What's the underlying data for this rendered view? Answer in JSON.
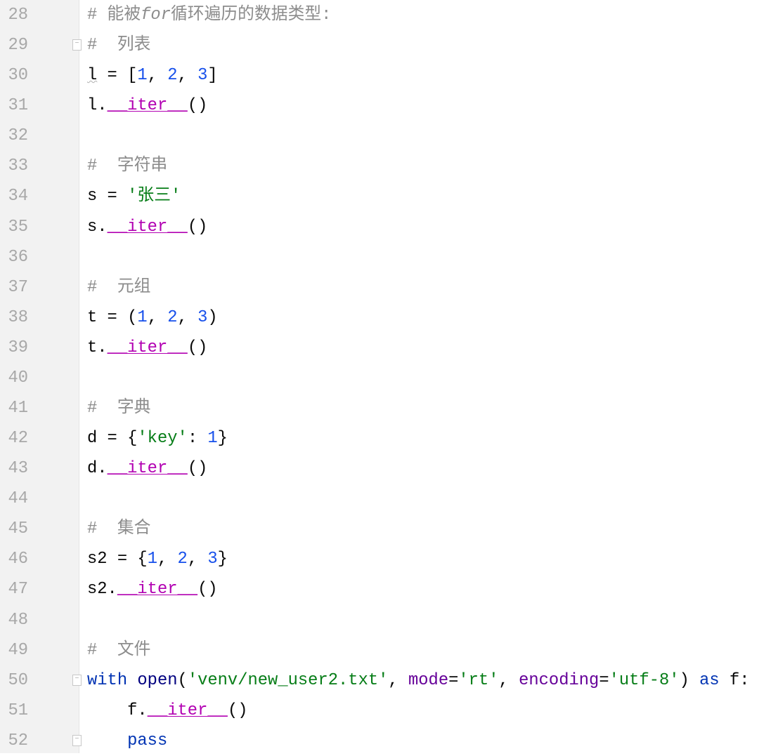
{
  "editor": {
    "colors": {
      "comment": "#8c8c8c",
      "number": "#1750eb",
      "string": "#067d17",
      "dunder": "#b200b2",
      "keyword": "#0033b3",
      "builtin": "#000080",
      "param": "#660099",
      "gutter_bg": "#f2f2f2"
    },
    "lines": [
      {
        "n": "28",
        "tokens": [
          [
            "# 能被",
            "comment"
          ],
          [
            "for",
            "italic"
          ],
          [
            "循环遍历的数据类型:",
            "comment"
          ]
        ]
      },
      {
        "n": "29",
        "fold": "fold-start-icon",
        "tokens": [
          [
            "#  列表",
            "comment"
          ]
        ]
      },
      {
        "n": "30",
        "tokens": [
          [
            "l",
            "warn"
          ],
          [
            " = [",
            ""
          ],
          [
            "1",
            "number"
          ],
          [
            ", ",
            ""
          ],
          [
            "2",
            "number"
          ],
          [
            ", ",
            ""
          ],
          [
            "3",
            "number"
          ],
          [
            "]",
            ""
          ]
        ]
      },
      {
        "n": "31",
        "tokens": [
          [
            "l.",
            ""
          ],
          [
            "__iter__",
            "dunder"
          ],
          [
            "()",
            ""
          ]
        ]
      },
      {
        "n": "32",
        "tokens": []
      },
      {
        "n": "33",
        "tokens": [
          [
            "#  字符串",
            "comment"
          ]
        ]
      },
      {
        "n": "34",
        "tokens": [
          [
            "s = ",
            ""
          ],
          [
            "'张三'",
            "string"
          ]
        ]
      },
      {
        "n": "35",
        "tokens": [
          [
            "s.",
            ""
          ],
          [
            "__iter__",
            "dunder"
          ],
          [
            "()",
            ""
          ]
        ]
      },
      {
        "n": "36",
        "tokens": []
      },
      {
        "n": "37",
        "tokens": [
          [
            "#  元组",
            "comment"
          ]
        ]
      },
      {
        "n": "38",
        "tokens": [
          [
            "t = (",
            ""
          ],
          [
            "1",
            "number"
          ],
          [
            ", ",
            ""
          ],
          [
            "2",
            "number"
          ],
          [
            ", ",
            ""
          ],
          [
            "3",
            "number"
          ],
          [
            ")",
            ""
          ]
        ]
      },
      {
        "n": "39",
        "tokens": [
          [
            "t.",
            ""
          ],
          [
            "__iter__",
            "dunder"
          ],
          [
            "()",
            ""
          ]
        ]
      },
      {
        "n": "40",
        "tokens": []
      },
      {
        "n": "41",
        "tokens": [
          [
            "#  字典",
            "comment"
          ]
        ]
      },
      {
        "n": "42",
        "tokens": [
          [
            "d = {",
            ""
          ],
          [
            "'key'",
            "string"
          ],
          [
            ": ",
            ""
          ],
          [
            "1",
            "number"
          ],
          [
            "}",
            ""
          ]
        ]
      },
      {
        "n": "43",
        "tokens": [
          [
            "d.",
            ""
          ],
          [
            "__iter__",
            "dunder"
          ],
          [
            "()",
            ""
          ]
        ]
      },
      {
        "n": "44",
        "tokens": []
      },
      {
        "n": "45",
        "tokens": [
          [
            "#  集合",
            "comment"
          ]
        ]
      },
      {
        "n": "46",
        "tokens": [
          [
            "s2 = {",
            ""
          ],
          [
            "1",
            "number"
          ],
          [
            ", ",
            ""
          ],
          [
            "2",
            "number"
          ],
          [
            ", ",
            ""
          ],
          [
            "3",
            "number"
          ],
          [
            "}",
            ""
          ]
        ]
      },
      {
        "n": "47",
        "tokens": [
          [
            "s2.",
            ""
          ],
          [
            "__iter__",
            "dunder"
          ],
          [
            "()",
            ""
          ]
        ]
      },
      {
        "n": "48",
        "tokens": []
      },
      {
        "n": "49",
        "tokens": [
          [
            "#  文件",
            "comment"
          ]
        ]
      },
      {
        "n": "50",
        "fold": "fold-start-icon",
        "tokens": [
          [
            "with",
            "keyword"
          ],
          [
            " ",
            ""
          ],
          [
            "open",
            "builtin"
          ],
          [
            "(",
            ""
          ],
          [
            "'venv/new_user2.txt'",
            "string"
          ],
          [
            ", ",
            ""
          ],
          [
            "mode",
            "param"
          ],
          [
            "=",
            ""
          ],
          [
            "'rt'",
            "string"
          ],
          [
            ", ",
            ""
          ],
          [
            "encoding",
            "param"
          ],
          [
            "=",
            ""
          ],
          [
            "'utf-8'",
            "string"
          ],
          [
            ") ",
            ""
          ],
          [
            "as",
            "keyword"
          ],
          [
            " f:",
            ""
          ]
        ]
      },
      {
        "n": "51",
        "tokens": [
          [
            "    f.",
            ""
          ],
          [
            "__iter__",
            "dunder"
          ],
          [
            "()",
            ""
          ]
        ]
      },
      {
        "n": "52",
        "fold": "fold-end-icon",
        "tokens": [
          [
            "    ",
            ""
          ],
          [
            "pass",
            "keyword"
          ]
        ]
      }
    ]
  }
}
